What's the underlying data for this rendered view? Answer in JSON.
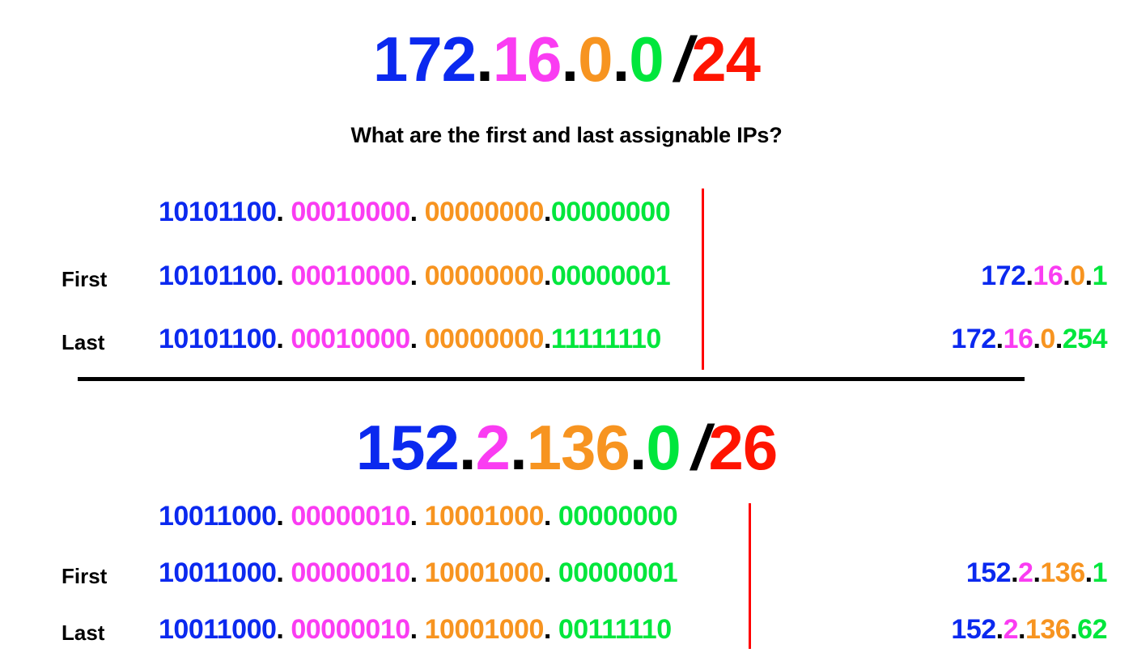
{
  "colors": {
    "blue": "#0B29EF",
    "magenta": "#FA3CF2",
    "orange": "#F79420",
    "green": "#00E63C",
    "red": "#FF1400",
    "black": "#000000",
    "boundary_line": "#FF0000",
    "divider": "#000000",
    "background": "#FFFFFF"
  },
  "subtitle": "What are the first and last assignable IPs?",
  "blocks": [
    {
      "id": "block-1",
      "title": {
        "octet1": "172",
        "octet2": "16",
        "octet3": "0",
        "octet4": "0",
        "slash": "/",
        "prefix": "24"
      },
      "rows": [
        {
          "label": "",
          "binary": {
            "octet1": "10101100",
            "octet2": "00010000",
            "octet3": "00000000",
            "octet4": "00000000"
          },
          "ip": null
        },
        {
          "label": "First",
          "binary": {
            "octet1": "10101100",
            "octet2": "00010000",
            "octet3": "00000000",
            "octet4": "00000001"
          },
          "ip": {
            "octet1": "172",
            "octet2": "16",
            "octet3": "0",
            "octet4": "1"
          }
        },
        {
          "label": "Last",
          "binary": {
            "octet1": "10101100",
            "octet2": "00010000",
            "octet3": "00000000",
            "octet4": "11111110"
          },
          "ip": {
            "octet1": "172",
            "octet2": "16",
            "octet3": "0",
            "octet4": "254"
          }
        }
      ]
    },
    {
      "id": "block-2",
      "title": {
        "octet1": "152",
        "octet2": "2",
        "octet3": "136",
        "octet4": "0",
        "slash": "/",
        "prefix": "26"
      },
      "rows": [
        {
          "label": "",
          "binary": {
            "octet1": "10011000",
            "octet2": "00000010",
            "octet3": "10001000",
            "octet4": "00000000"
          },
          "ip": null
        },
        {
          "label": "First",
          "binary": {
            "octet1": "10011000",
            "octet2": "00000010",
            "octet3": "10001000",
            "octet4": "00000001"
          },
          "ip": {
            "octet1": "152",
            "octet2": "2",
            "octet3": "136",
            "octet4": "1"
          }
        },
        {
          "label": "Last",
          "binary": {
            "octet1": "10011000",
            "octet2": "00000010",
            "octet3": "10001000",
            "octet4": "00111110"
          },
          "ip": {
            "octet1": "152",
            "octet2": "2",
            "octet3": "136",
            "octet4": "62"
          }
        }
      ]
    }
  ],
  "separators": {
    "dot": ".",
    "dot_binary": "."
  }
}
